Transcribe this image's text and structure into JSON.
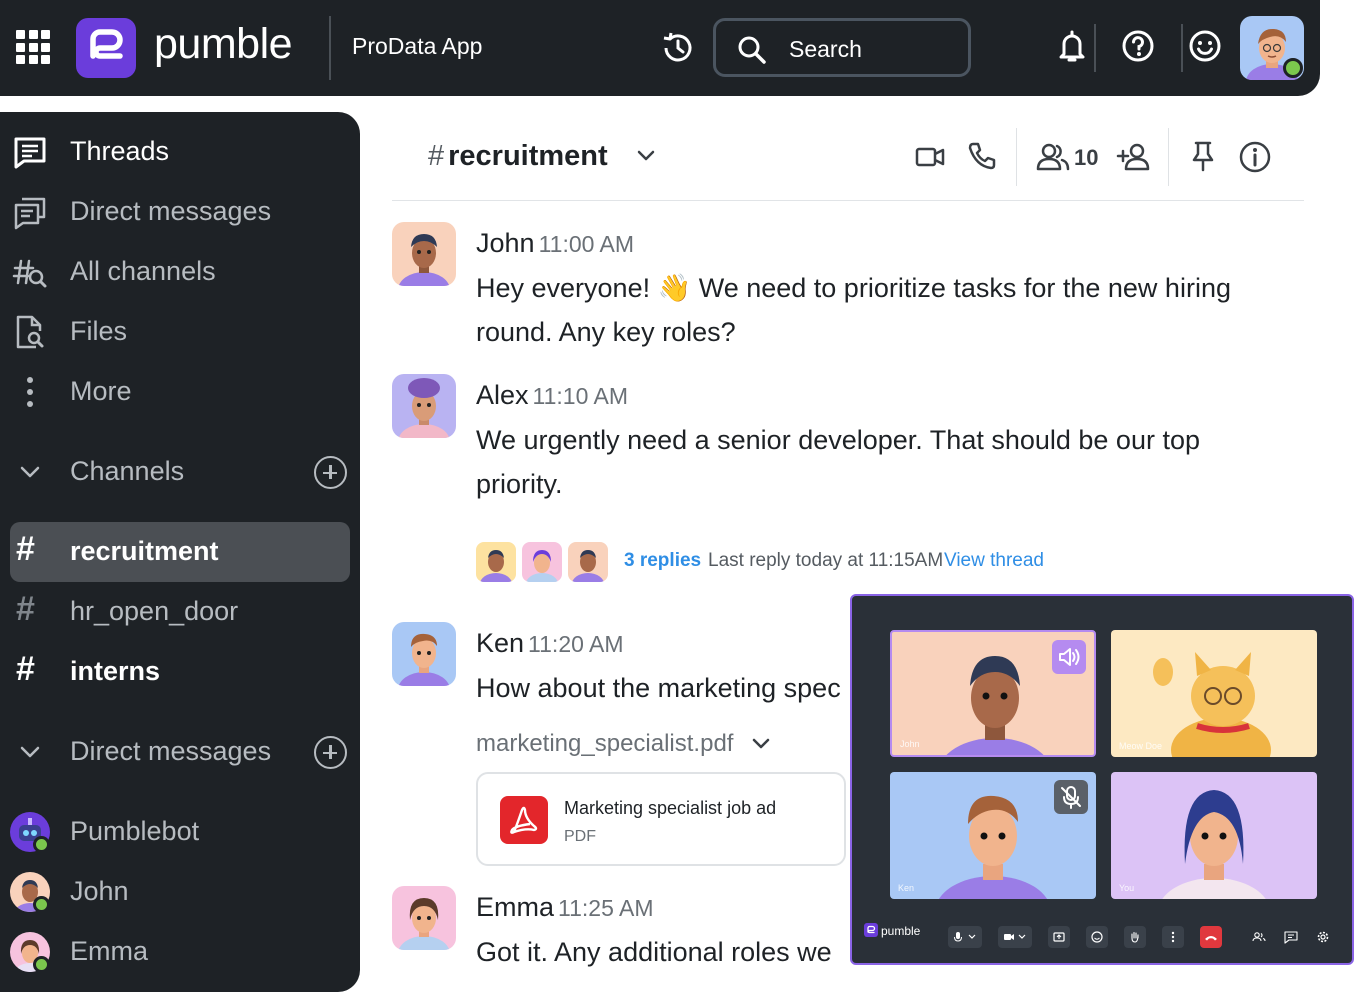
{
  "topbar": {
    "brand": "pumble",
    "workspace": "ProData App",
    "search_label": "Search"
  },
  "sidebar": {
    "nav": [
      {
        "label": "Threads",
        "icon": "threads-icon"
      },
      {
        "label": "Direct messages",
        "icon": "direct-messages-icon"
      },
      {
        "label": "All channels",
        "icon": "all-channels-icon"
      },
      {
        "label": "Files",
        "icon": "files-icon"
      },
      {
        "label": "More",
        "icon": "more-icon"
      }
    ],
    "channels_header": "Channels",
    "channels": [
      {
        "name": "recruitment",
        "active": true
      },
      {
        "name": "hr_open_door",
        "active": false
      },
      {
        "name": "interns",
        "active": false
      }
    ],
    "dm_header": "Direct messages",
    "dms": [
      {
        "name": "Pumblebot"
      },
      {
        "name": "John"
      },
      {
        "name": "Emma"
      }
    ]
  },
  "channel": {
    "hash": "#",
    "name": "recruitment",
    "member_count": "10"
  },
  "messages": [
    {
      "author": "John",
      "time": "11:00 AM",
      "text": "Hey everyone! 👋 We need to prioritize tasks for the new hiring round. Any key roles?"
    },
    {
      "author": "Alex",
      "time": "11:10 AM",
      "text": "We urgently need a senior developer. That should be our top priority."
    },
    {
      "author": "Ken",
      "time": "11:20 AM",
      "text": "How about the marketing spec"
    },
    {
      "author": "Emma",
      "time": "11:25 AM",
      "text": "Got it. Any additional roles we"
    }
  ],
  "thread": {
    "replies": "3 replies",
    "last_reply": "Last reply today at 11:15AM",
    "view": "View thread"
  },
  "attachment": {
    "file_name": "marketing_specialist.pdf",
    "title": "Marketing specialist job ad",
    "type": "PDF"
  },
  "call": {
    "brand": "pumble",
    "participants": [
      {
        "name": "John",
        "bg": "#f9d2bc"
      },
      {
        "name": "Meow Doe",
        "bg": "#fde9c2"
      },
      {
        "name": "Ken",
        "bg": "#a9c8f5"
      },
      {
        "name": "You",
        "bg": "#dcc3f6"
      }
    ]
  },
  "colors": {
    "dark": "#1e2226",
    "brand": "#6b3ddb",
    "link": "#2f8ee5",
    "online": "#7bc74d",
    "active_channel": "#4b4f54"
  }
}
